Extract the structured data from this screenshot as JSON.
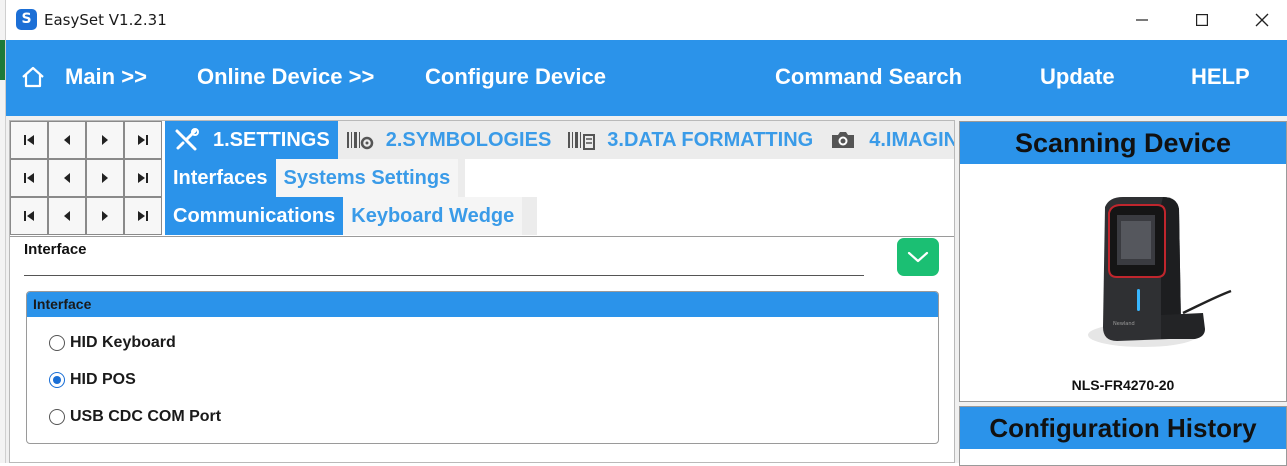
{
  "window": {
    "title": "EasySet V1.2.31",
    "icon_letter": "S"
  },
  "navbar": {
    "items": [
      {
        "label": "Main >>"
      },
      {
        "label": "Online Device >>"
      },
      {
        "label": "Configure Device"
      },
      {
        "label": "Command Search"
      },
      {
        "label": "Update"
      },
      {
        "label": "HELP"
      }
    ]
  },
  "tabs": {
    "row1": [
      {
        "label": "1.SETTINGS",
        "icon": "tools-icon",
        "active": true
      },
      {
        "label": "2.SYMBOLOGIES",
        "icon": "barcode-gear-icon",
        "active": false
      },
      {
        "label": "3.DATA FORMATTING",
        "icon": "barcode-doc-icon",
        "active": false
      },
      {
        "label": "4.IMAGIN",
        "icon": "camera-icon",
        "active": false
      }
    ],
    "row2": [
      {
        "label": "Interfaces",
        "active": true
      },
      {
        "label": "Systems Settings",
        "active": false
      }
    ],
    "row3": [
      {
        "label": "Communications",
        "active": true
      },
      {
        "label": "Keyboard Wedge",
        "active": false
      }
    ]
  },
  "content": {
    "field_label": "Interface",
    "group_title": "Interface",
    "options": [
      {
        "label": "HID Keyboard",
        "selected": false
      },
      {
        "label": "HID POS",
        "selected": true
      },
      {
        "label": "USB CDC COM Port",
        "selected": false
      }
    ]
  },
  "right": {
    "scan_title": "Scanning Device",
    "device_name": "NLS-FR4270-20",
    "history_title": "Configuration History"
  },
  "colors": {
    "accent": "#2b93ea",
    "confirm": "#1bbf73",
    "tab_text": "#3a9be8"
  }
}
